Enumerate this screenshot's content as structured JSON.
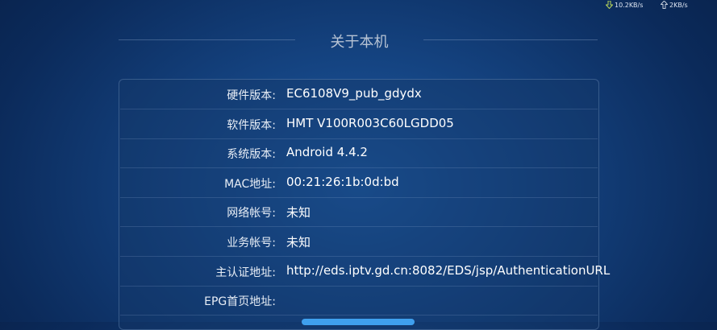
{
  "status_bar": {
    "download_speed": "10.2KB/s",
    "upload_speed": "2KB/s",
    "download_icon": "download-arrow-icon",
    "upload_icon": "upload-arrow-icon"
  },
  "page": {
    "title": "关于本机"
  },
  "info": {
    "rows": [
      {
        "label": "硬件版本:",
        "value": "EC6108V9_pub_gdydx"
      },
      {
        "label": "软件版本:",
        "value": "HMT V100R003C60LGDD05"
      },
      {
        "label": "系统版本:",
        "value": "Android 4.4.2"
      },
      {
        "label": "MAC地址:",
        "value": "00:21:26:1b:0d:bd"
      },
      {
        "label": "网络帐号:",
        "value": "未知"
      },
      {
        "label": "业务帐号:",
        "value": "未知"
      },
      {
        "label": "主认证地址:",
        "value": "http://eds.iptv.gd.cn:8082/EDS/jsp/AuthenticationURL"
      },
      {
        "label": "EPG首页地址:",
        "value": ""
      }
    ]
  },
  "colors": {
    "background": "#14427f",
    "accent_button": "#3fa0ee",
    "status_icon": "#b8d65a"
  }
}
